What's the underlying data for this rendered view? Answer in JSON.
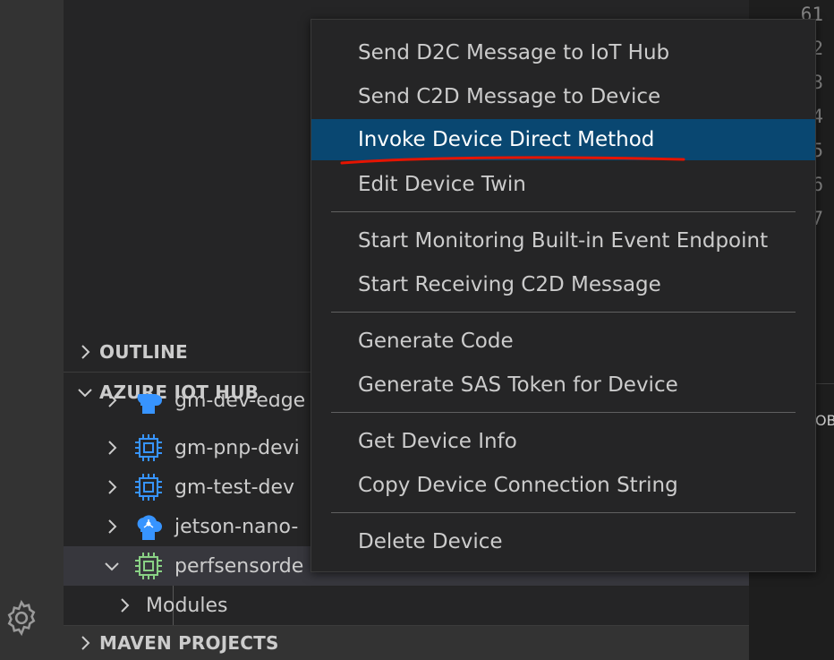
{
  "menu": {
    "items": [
      "Send D2C Message to IoT Hub",
      "Send C2D Message to Device",
      "Invoke Device Direct Method",
      "Edit Device Twin",
      "Start Monitoring Built-in Event Endpoint",
      "Start Receiving C2D Message",
      "Generate Code",
      "Generate SAS Token for Device",
      "Get Device Info",
      "Copy Device Connection String",
      "Delete Device"
    ],
    "highlighted_index": 2,
    "annotation_color": "#e51400"
  },
  "sidebar": {
    "outline_label": "OUTLINE",
    "azure_label": "AZURE IOT HUB",
    "maven_label": "MAVEN PROJECTS",
    "devices": [
      {
        "label": "gm-dev-edge",
        "icon": "edge-device-icon"
      },
      {
        "label": "gm-pnp-devi",
        "icon": "chip-device-icon"
      },
      {
        "label": "gm-test-dev",
        "icon": "chip-device-icon"
      },
      {
        "label": "jetson-nano-",
        "icon": "edge-device-icon"
      },
      {
        "label": "perfsensorde",
        "icon": "chip-device-icon-green"
      }
    ],
    "modules_label": "Modules"
  },
  "editor": {
    "line_numbers": [
      "61",
      "2",
      "3",
      "4",
      "5",
      "6",
      "7"
    ],
    "fragment": "OB"
  },
  "colors": {
    "highlight": "#094771",
    "device_icon": "#3794ff",
    "connected_icon": "#89d185"
  }
}
